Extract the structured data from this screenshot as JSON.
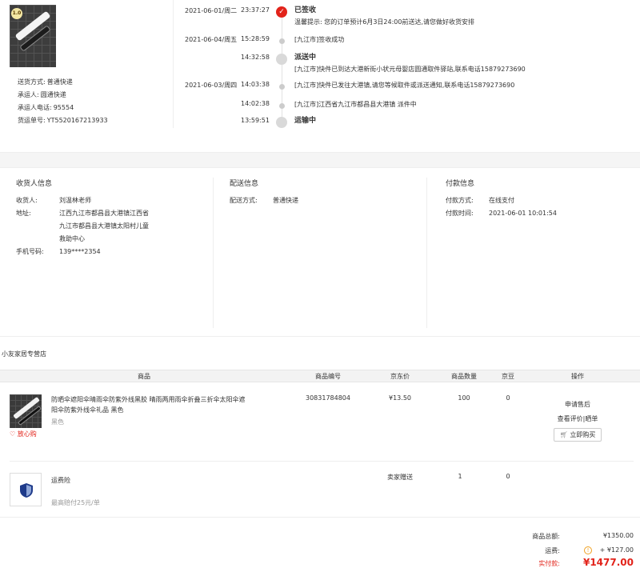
{
  "shipping": {
    "method_label": "送货方式:",
    "method": "普通快递",
    "carrier_label": "承运人:",
    "carrier": "圆通快递",
    "carrier_phone_label": "承运人电话:",
    "carrier_phone": "95554",
    "tracking_label": "货运单号:",
    "tracking_no": "YT5520167213933"
  },
  "timeline": [
    {
      "date": "2021-06-01/周二",
      "time": "23:37:27",
      "status": "已签收",
      "text": "温馨提示: 您的订单预计6月3日24:00前送达,请您做好收货安排"
    },
    {
      "date": "2021-06-04/周五",
      "time": "15:28:59",
      "status": "",
      "text": "[九江市]签收成功"
    },
    {
      "date": "",
      "time": "14:32:58",
      "status": "派送中",
      "text": "[九江市]快件已到达大港新街小状元母婴店圆通取件驿站,联系电话15879273690"
    },
    {
      "date": "2021-06-03/周四",
      "time": "14:03:38",
      "status": "",
      "text": "[九江市]快件已发往大港镇,请您等候取件或派送通知,联系电话15879273690"
    },
    {
      "date": "",
      "time": "14:02:38",
      "status": "",
      "text": "[九江市]江西省九江市都昌县大港镇 派件中"
    },
    {
      "date": "",
      "time": "13:59:51",
      "status": "运输中",
      "text": ""
    }
  ],
  "receiver": {
    "heading": "收货人信息",
    "name_label": "收货人:",
    "name": "刘温林老师",
    "address_label": "地址:",
    "address_line1": "江西九江市都昌县大港镇江西省",
    "address_line2": "九江市都昌县大港镇太阳村儿童",
    "address_line3": "救助中心",
    "phone_label": "手机号码:",
    "phone": "139****2354"
  },
  "delivery": {
    "heading": "配送信息",
    "method_label": "配送方式:",
    "method": "普通快递"
  },
  "payment": {
    "heading": "付款信息",
    "method_label": "付款方式:",
    "method": "在线支付",
    "time_label": "付款时间:",
    "time": "2021-06-01 10:01:54"
  },
  "shop": {
    "name": "小友家居专营店"
  },
  "table_headers": {
    "product": "商品",
    "sku": "商品编号",
    "price": "京东价",
    "qty": "商品数量",
    "jd_beans": "京豆",
    "ops": "操作"
  },
  "product": {
    "title": "防晒伞遮阳伞晴雨伞防紫外线黑胶 晴雨两用雨伞折叠三折伞太阳伞遮阳伞防紫外线伞礼品 黑色",
    "color": "黑色",
    "badge": "放心购",
    "sku": "30831784804",
    "price": "¥13.50",
    "qty": "100",
    "beans": "0",
    "op_aftersale": "申请售后",
    "op_review": "查看评价|晒单",
    "op_buy": "立即购买"
  },
  "insurance": {
    "name": "运费险",
    "note": "最高赔付25元/单",
    "price": "卖家赠送",
    "qty": "1",
    "beans": "0"
  },
  "summary": {
    "goods_label": "商品总额:",
    "goods": "¥1350.00",
    "freight_label": "运费:",
    "freight": "+ ¥127.00",
    "paid_label": "实付款:",
    "paid": "¥1477.00"
  },
  "colors": {
    "accent": "#e2231a",
    "warning": "#f0a020",
    "security": "#1e3a8a"
  }
}
